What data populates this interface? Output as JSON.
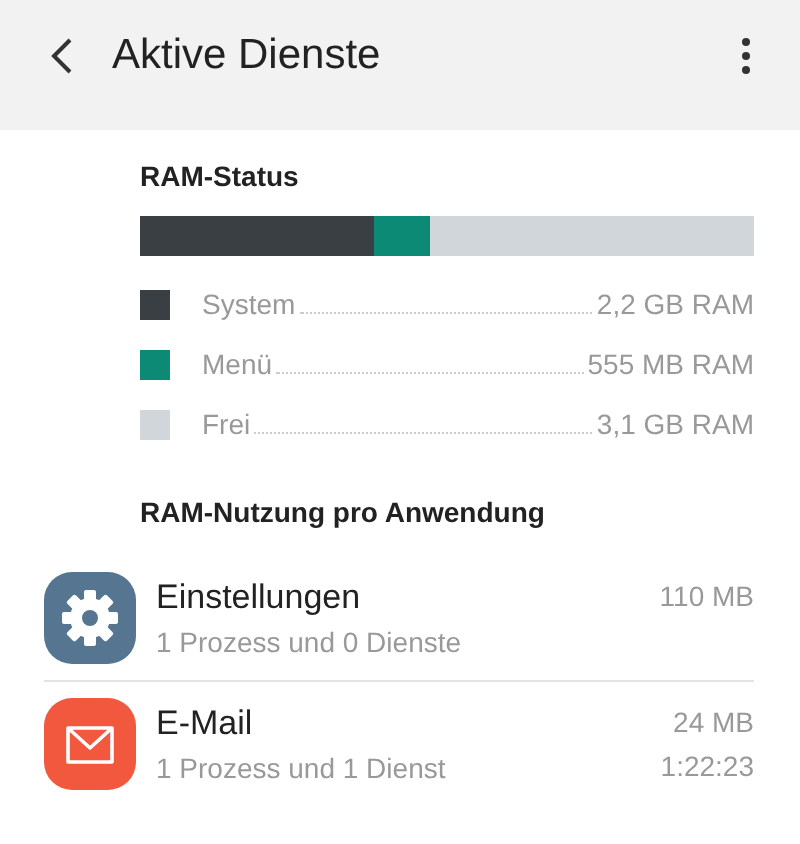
{
  "header": {
    "title": "Aktive Dienste"
  },
  "ram_status": {
    "title": "RAM-Status",
    "segments": [
      {
        "label": "System",
        "value": "2,2 GB RAM",
        "color": "#3a3f44"
      },
      {
        "label": "Menü",
        "value": "555 MB RAM",
        "color": "#0c8a76"
      },
      {
        "label": "Frei",
        "value": "3,1 GB RAM",
        "color": "#d0d6d9"
      }
    ]
  },
  "apps": {
    "title": "RAM-Nutzung pro Anwendung",
    "items": [
      {
        "kind": "settings",
        "name": "Einstellungen",
        "detail": "1 Prozess und 0 Dienste",
        "size": "110 MB"
      },
      {
        "kind": "mail",
        "name": "E-Mail",
        "detail": "1 Prozess und 1 Dienst",
        "size": "24 MB",
        "time": "1:22:23"
      }
    ]
  }
}
